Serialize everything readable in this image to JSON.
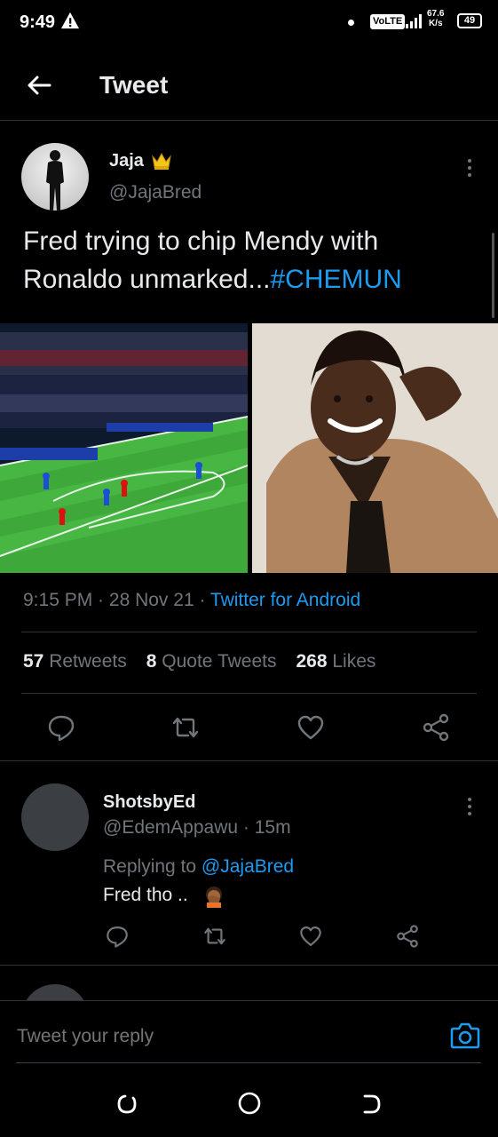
{
  "status_bar": {
    "time": "9:49",
    "network": "VoLTE",
    "speed_value": "67.6",
    "speed_unit": "K/s",
    "battery": "49"
  },
  "header": {
    "title": "Tweet"
  },
  "tweet": {
    "author_name": "Jaja",
    "author_handle": "@JajaBred",
    "text": "Fred trying to chip Mendy with Ronaldo unmarked...",
    "hashtag": "#CHEMUN",
    "time": "9:15 PM",
    "date": "28 Nov 21",
    "source": "Twitter for Android",
    "retweets_count": "57",
    "retweets_label": "Retweets",
    "quotes_count": "8",
    "quotes_label": "Quote Tweets",
    "likes_count": "268",
    "likes_label": "Likes"
  },
  "reply": {
    "author_name": "ShotsbyEd",
    "author_handle": "@EdemAppawu",
    "age": "15m",
    "replying_prefix": "Replying to",
    "replying_to": "@JajaBred",
    "text": "Fred tho .."
  },
  "composer": {
    "placeholder": "Tweet your reply"
  },
  "colors": {
    "background": "#000000",
    "accent": "#1d9bf0",
    "muted": "#71767b",
    "divider": "#2f3336"
  }
}
